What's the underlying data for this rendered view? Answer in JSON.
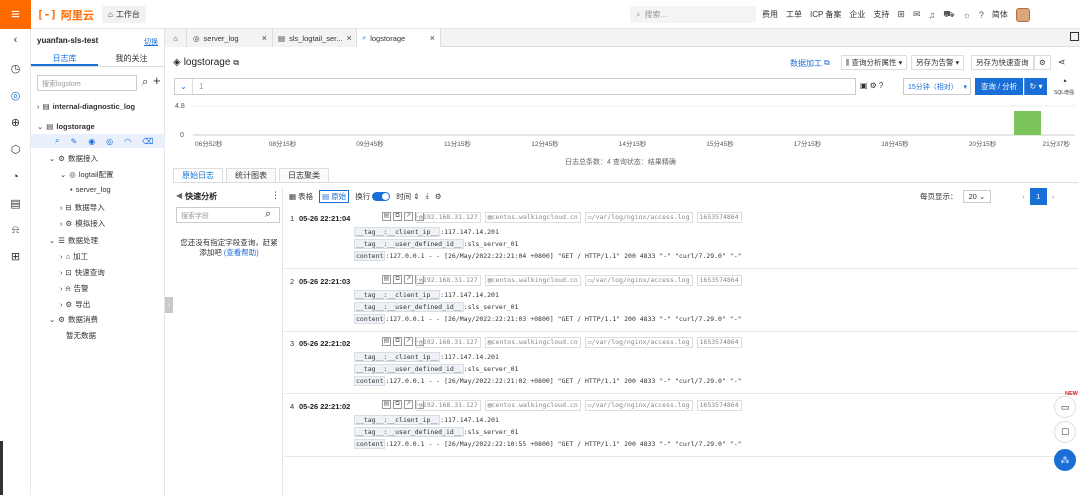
{
  "topbar": {
    "logo_mark": "[-]",
    "logo_text": "阿里云",
    "workbench": "工作台",
    "search_placeholder": "搜索...",
    "nav": [
      "费用",
      "工单",
      "ICP 备案",
      "企业",
      "支持"
    ],
    "language": "简体"
  },
  "sidebar": {
    "project": "yuanfan-sls-test",
    "switch": "切换",
    "tabs": [
      "日志库",
      "我的关注"
    ],
    "search_placeholder": "搜索logstore",
    "stores": [
      "internal-diagnostic_log",
      "logstorage"
    ],
    "tree": {
      "data_ingest": "数据接入",
      "logtail_config": "logtail配置",
      "server_log": "server_log",
      "data_import": "数据导入",
      "mock_ingest": "模拟接入",
      "data_processing": "数据处理",
      "process": "加工",
      "quick_query": "快速查询",
      "alert": "告警",
      "export": "导出",
      "consumption": "数据消费",
      "no_data": "暂无数据"
    }
  },
  "tabs": [
    {
      "label": "server_log"
    },
    {
      "label": "sls_logtail_ser..."
    },
    {
      "label": "logstorage"
    }
  ],
  "query_header": {
    "store": "logstorage",
    "data_process": "数据加工",
    "query_attr": "查询分析属性",
    "save_alert": "另存为告警",
    "save_quick": "另存为快速查询"
  },
  "query_bar": {
    "line_no": "1",
    "time_range": "15分钟（相对）",
    "search_btn": "查询 / 分析",
    "upgrade": "SQL增强"
  },
  "histogram": {
    "y_max": "4.8",
    "y_min": "0",
    "x_ticks": [
      "06分52秒",
      "08分15秒",
      "09分45秒",
      "11分15秒",
      "12分45秒",
      "14分15秒",
      "15分45秒",
      "17分15秒",
      "18分45秒",
      "20分15秒",
      "21分37秒"
    ],
    "status": "日志总条数：4  查询状态：结果精确"
  },
  "result_tabs": [
    "原始日志",
    "统计图表",
    "日志聚类"
  ],
  "quick_analysis": {
    "title": "快速分析",
    "search_placeholder": "搜索字段",
    "hint": "您还没有指定字段查询，赶紧添加吧",
    "help": "(查看帮助)"
  },
  "log_toolbar": {
    "table": "表格",
    "raw": "原始",
    "wrap": "换行",
    "time": "时间",
    "per_page_label": "每页显示：",
    "per_page": "20",
    "page": "1"
  },
  "logs": [
    {
      "idx": "1",
      "time": "05-26 22:21:04",
      "ip": "192.168.31.127",
      "host": "centos.walkingcloud.cn",
      "path": "/var/log/nginx/access.log",
      "ts": "1653574864",
      "client_ip_key": "__tag__:__client_ip__",
      "client_ip": ":117.147.14.201",
      "user_key": "__tag__:__user_defined_id__",
      "user": ":sls_server_01",
      "content_key": "content",
      "content": ":127.0.0.1 - - [26/May/2022:22:21:04 +0800] \"GET / HTTP/1.1\" 200 4833 \"-\" \"curl/7.29.0\" \"-\""
    },
    {
      "idx": "2",
      "time": "05-26 22:21:03",
      "ip": "192.168.31.127",
      "host": "centos.walkingcloud.cn",
      "path": "/var/log/nginx/access.log",
      "ts": "1653574864",
      "client_ip_key": "__tag__:__client_ip__",
      "client_ip": ":117.147.14.201",
      "user_key": "__tag__:__user_defined_id__",
      "user": ":sls_server_01",
      "content_key": "content",
      "content": ":127.0.0.1 - - [26/May/2022:22:21:03 +0800] \"GET / HTTP/1.1\" 200 4833 \"-\" \"curl/7.29.0\" \"-\""
    },
    {
      "idx": "3",
      "time": "05-26 22:21:02",
      "ip": "192.168.31.127",
      "host": "centos.walkingcloud.cn",
      "path": "/var/log/nginx/access.log",
      "ts": "1653574864",
      "client_ip_key": "__tag__:__client_ip__",
      "client_ip": ":117.147.14.201",
      "user_key": "__tag__:__user_defined_id__",
      "user": ":sls_server_01",
      "content_key": "content",
      "content": ":127.0.0.1 - - [26/May/2022:22:21:02 +0800] \"GET / HTTP/1.1\" 200 4833 \"-\" \"curl/7.29.0\" \"-\""
    },
    {
      "idx": "4",
      "time": "05-26 22:21:02",
      "ip": "192.168.31.127",
      "host": "centos.walkingcloud.cn",
      "path": "/var/log/nginx/access.log",
      "ts": "1653574864",
      "client_ip_key": "__tag__:__client_ip__",
      "client_ip": ":117.147.14.201",
      "user_key": "__tag__:__user_defined_id__",
      "user": ":sls_server_01",
      "content_key": "content",
      "content": ":127.0.0.1 - - [26/May/2022:22:10:55 +0800] \"GET / HTTP/1.1\" 200 4833 \"-\" \"curl/7.29.0\" \"-\""
    }
  ],
  "float": {
    "new_badge": "NEW"
  },
  "colors": {
    "brand": "#ff6a00",
    "accent": "#1a6fd6",
    "bar": "#7dc55a"
  }
}
